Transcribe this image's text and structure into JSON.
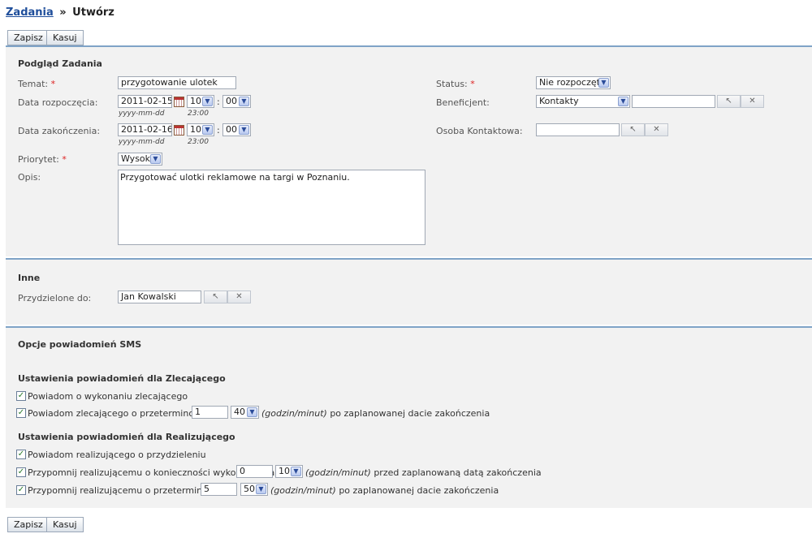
{
  "breadcrumb": {
    "parent": "Zadania",
    "separator": "»",
    "current": "Utwórz"
  },
  "buttons": {
    "save": "Zapisz",
    "cancel": "Kasuj"
  },
  "task_preview": {
    "title": "Podgląd Zadania",
    "topic_label": "Temat:",
    "topic_value": "przygotowanie ulotek",
    "start_label": "Data rozpoczęcia:",
    "start_date": "2011-02-15",
    "start_hour": "10",
    "start_minute": "00",
    "end_label": "Data zakończenia:",
    "end_date": "2011-02-16",
    "end_hour": "10",
    "end_minute": "00",
    "date_format_hint": "yyyy-mm-dd",
    "time_hint": "23:00",
    "time_separator": ":",
    "priority_label": "Priorytet:",
    "priority_value": "Wysoki",
    "description_label": "Opis:",
    "description_value": "Przygotować ulotki reklamowe na targi w Poznaniu.",
    "status_label": "Status:",
    "status_value": "Nie rozpoczęte",
    "beneficiary_label": "Beneficjent:",
    "beneficiary_type": "Kontakty",
    "beneficiary_value": "",
    "contact_person_label": "Osoba Kontaktowa:",
    "contact_person_value": "",
    "required_mark": "*"
  },
  "other": {
    "title": "Inne",
    "assigned_label": "Przydzielone do:",
    "assigned_value": "Jan Kowalski"
  },
  "sms": {
    "title": "Opcje powiadomień SMS",
    "requester_heading": "Ustawienia powiadomień dla Zlecającego",
    "notify_requester_done": "Powiadom o wykonaniu zlecającego",
    "notify_requester_overdue": "Powiadom zlecającego o przeterminowaniu",
    "requester_overdue_amount": "1",
    "requester_overdue_unit": "40",
    "unit_hint": "(godzin/minut)",
    "after_planned_end": "po zaplanowanej dacie zakończenia",
    "executor_heading": "Ustawienia powiadomień dla Realizującego",
    "notify_executor_assigned": "Powiadom realizującego o przydzieleniu",
    "remind_executor_due": "Przypomnij realizującemu o konieczności wykonania na",
    "executor_due_amount": "0",
    "executor_due_unit": "10",
    "before_planned_end": "przed zaplanowaną datą zakończenia",
    "remind_executor_overdue": "Przypomnij realizującemu o przeterminowaniu",
    "executor_overdue_amount": "5",
    "executor_overdue_unit": "50",
    "checkmark": "✓"
  },
  "icons": {
    "calendar": "calendar-icon",
    "cursor": "cursor-icon",
    "clear": "clear-icon",
    "dropdown": "chevron-down-icon"
  }
}
